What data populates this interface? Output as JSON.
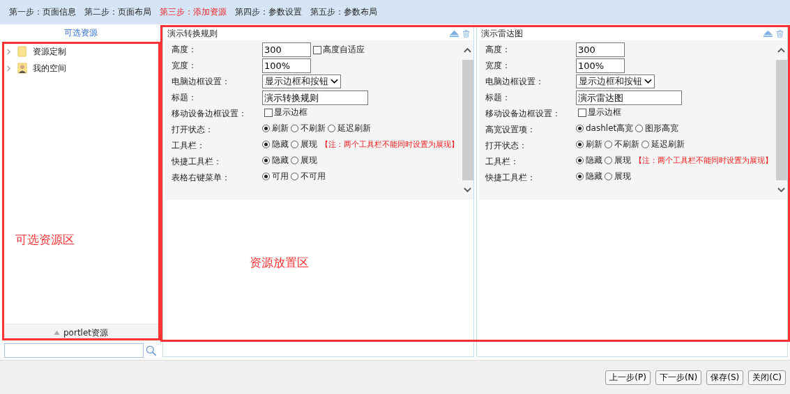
{
  "steps": [
    {
      "label": "第一步：页面信息",
      "selected": false
    },
    {
      "label": "第二步：页面布局",
      "selected": false
    },
    {
      "label": "第三步：添加资源",
      "selected": true
    },
    {
      "label": "第四步：参数设置",
      "selected": false
    },
    {
      "label": "第五步：参数布局",
      "selected": false
    }
  ],
  "sidebar": {
    "title": "可选资源",
    "tree": [
      {
        "label": "资源定制",
        "kind": "folder",
        "expanded": false
      },
      {
        "label": "我的空间",
        "kind": "user",
        "expanded": false
      }
    ],
    "footer": "portlet资源"
  },
  "portlets": [
    {
      "title": "演示转换规则",
      "fields": [
        {
          "label": "高度：",
          "kind": "text",
          "value": "300",
          "checkbox": {
            "label": "高度自适应",
            "checked": false
          }
        },
        {
          "label": "宽度：",
          "kind": "text",
          "value": "100%"
        },
        {
          "label": "电脑边框设置：",
          "kind": "select",
          "value": "显示边框和按钮"
        },
        {
          "label": "标题：",
          "kind": "wide",
          "value": "演示转换规则"
        },
        {
          "label": "移动设备边框设置：",
          "kind": "checkbox",
          "checkbox": {
            "label": "显示边框",
            "checked": false
          }
        },
        {
          "label": "打开状态：",
          "kind": "radio",
          "options": [
            {
              "label": "刷新",
              "selected": true
            },
            {
              "label": "不刷新",
              "selected": false
            },
            {
              "label": "延迟刷新",
              "selected": false
            }
          ]
        },
        {
          "label": "工具栏：",
          "kind": "radio",
          "options": [
            {
              "label": "隐藏",
              "selected": true
            },
            {
              "label": "展现",
              "selected": false
            }
          ],
          "note": "【注：两个工具栏不能同时设置为展现】"
        },
        {
          "label": "快捷工具栏：",
          "kind": "radio",
          "options": [
            {
              "label": "隐藏",
              "selected": true
            },
            {
              "label": "展现",
              "selected": false
            }
          ]
        },
        {
          "label": "表格右键菜单：",
          "kind": "radio",
          "options": [
            {
              "label": "可用",
              "selected": true
            },
            {
              "label": "不可用",
              "selected": false
            }
          ]
        }
      ]
    },
    {
      "title": "演示雷达图",
      "fields": [
        {
          "label": "高度：",
          "kind": "text",
          "value": "300"
        },
        {
          "label": "宽度：",
          "kind": "text",
          "value": "100%"
        },
        {
          "label": "电脑边框设置：",
          "kind": "select",
          "value": "显示边框和按钮"
        },
        {
          "label": "标题：",
          "kind": "wide",
          "value": "演示雷达图"
        },
        {
          "label": "移动设备边框设置：",
          "kind": "checkbox",
          "checkbox": {
            "label": "显示边框",
            "checked": false
          }
        },
        {
          "label": "高宽设置项：",
          "kind": "radio",
          "options": [
            {
              "label": "dashlet高宽",
              "selected": true
            },
            {
              "label": "图形高宽",
              "selected": false
            }
          ]
        },
        {
          "label": "打开状态：",
          "kind": "radio",
          "options": [
            {
              "label": "刷新",
              "selected": true
            },
            {
              "label": "不刷新",
              "selected": false
            },
            {
              "label": "延迟刷新",
              "selected": false
            }
          ]
        },
        {
          "label": "工具栏：",
          "kind": "radio",
          "options": [
            {
              "label": "隐藏",
              "selected": true
            },
            {
              "label": "展现",
              "selected": false
            }
          ],
          "note": "【注：两个工具栏不能同时设置为展现】"
        },
        {
          "label": "快捷工具栏：",
          "kind": "radio",
          "options": [
            {
              "label": "隐藏",
              "selected": true
            },
            {
              "label": "展现",
              "selected": false
            }
          ]
        }
      ]
    }
  ],
  "annotations": [
    {
      "label": "可选资源区"
    },
    {
      "label": "资源放置区"
    }
  ],
  "buttons": [
    "上一步(P)",
    "下一步(N)",
    "保存(S)",
    "关闭(C)"
  ]
}
